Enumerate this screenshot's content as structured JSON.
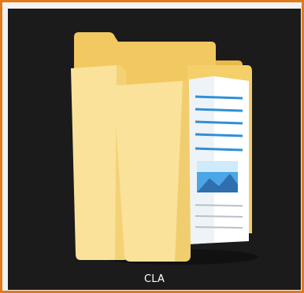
{
  "item": {
    "name": "CLA",
    "icon": "folder-with-documents-icon",
    "selected": true
  },
  "colors": {
    "selection_border": "#e07a1c",
    "tile_background": "#1b1b1b",
    "folder_light": "#fbe29a",
    "folder_mid": "#f5cf6a",
    "folder_dark": "#e9b94a",
    "paper_line": "#2f8fd8",
    "label_text": "#ffffff"
  }
}
